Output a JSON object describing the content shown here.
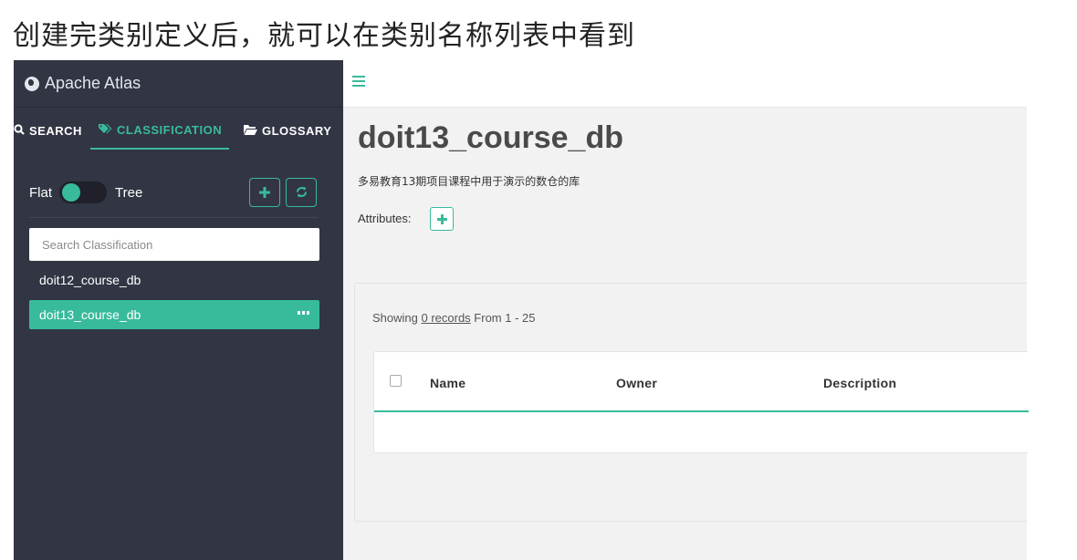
{
  "caption": "创建完类别定义后，就可以在类别名称列表中看到",
  "colors": {
    "accent": "#38bb9b",
    "sidebar_bg": "#323544",
    "main_bg": "#f2f2f2"
  },
  "sidebar": {
    "brand": "Apache Atlas",
    "brand_icon": "globe-icon",
    "tabs": [
      {
        "label": "SEARCH",
        "icon": "search-icon",
        "active": false
      },
      {
        "label": "CLASSIFICATION",
        "icon": "tag-icon",
        "active": true
      },
      {
        "label": "GLOSSARY",
        "icon": "folder-icon",
        "active": false
      }
    ],
    "toggle": {
      "left_label": "Flat",
      "right_label": "Tree",
      "state": "Flat"
    },
    "add_icon": "plus-icon",
    "refresh_icon": "refresh-icon",
    "search_placeholder": "Search Classification",
    "items": [
      {
        "label": "doit12_course_db",
        "active": false
      },
      {
        "label": "doit13_course_db",
        "active": true
      }
    ]
  },
  "main": {
    "menu_icon": "hamburger-icon",
    "title": "doit13_course_db",
    "description": "多易教育13期项目课程中用于演示的数仓的库",
    "attributes_label": "Attributes:",
    "showing_prefix": "Showing ",
    "showing_link": "0 records",
    "showing_suffix": " From 1 - 25",
    "columns": [
      "Name",
      "Owner",
      "Description"
    ]
  }
}
